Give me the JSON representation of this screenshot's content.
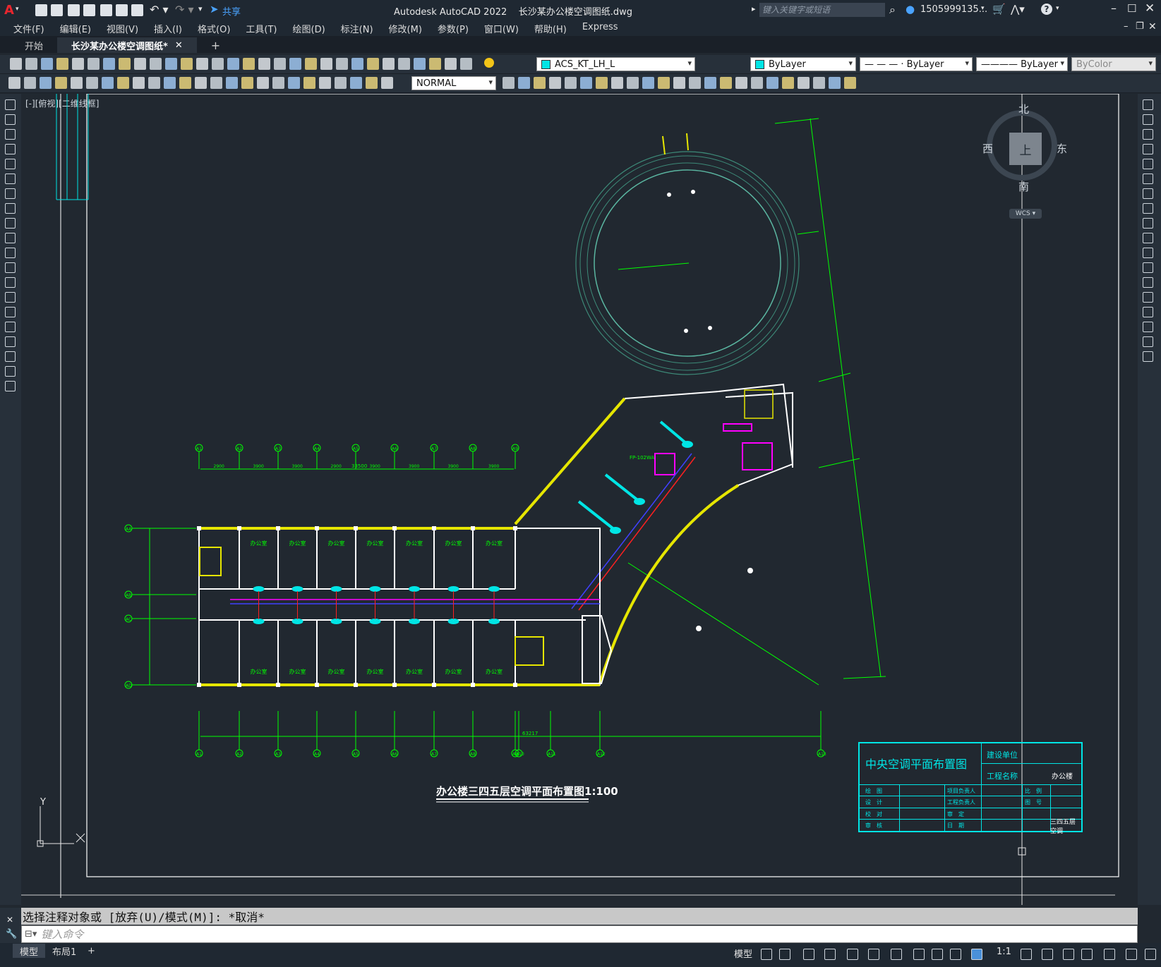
{
  "app": {
    "window_title": "Autodesk AutoCAD 2022    长沙某办公楼空调图纸.dwg",
    "share_label": "共享",
    "search_placeholder": "键入关键字或短语",
    "user_name": "1505999135..."
  },
  "menu": [
    "文件(F)",
    "编辑(E)",
    "视图(V)",
    "插入(I)",
    "格式(O)",
    "工具(T)",
    "绘图(D)",
    "标注(N)",
    "修改(M)",
    "参数(P)",
    "窗口(W)",
    "帮助(H)",
    "Express"
  ],
  "doc_tabs": [
    {
      "label": "开始",
      "active": false
    },
    {
      "label": "长沙某办公楼空调图纸*",
      "active": true
    }
  ],
  "properties": {
    "layer": "ACS_KT_LH_L",
    "color": "ByLayer",
    "linetype": "— — — · ByLayer",
    "lineweight": "———— ByLayer",
    "plotstyle": "ByColor",
    "dimstyle": "NORMAL",
    "layer_swatch": "#00e5e5",
    "color_swatch": "#00e5e5"
  },
  "viewport_label": "[-][俯视][二维线框]",
  "viewcube": {
    "north": "北",
    "south": "南",
    "east": "东",
    "west": "西",
    "face": "上",
    "wcs": "WCS"
  },
  "drawing": {
    "title": "办公楼三四五层空调平面布置图1:100",
    "title_block": {
      "name": "中央空调平面布置图",
      "fields": [
        "建设单位",
        "工程名称",
        "绘　图",
        "设　计",
        "校　对",
        "审　核",
        "项目负责人",
        "工程负责人",
        "审　定",
        "日　期",
        "比　例",
        "图　号"
      ],
      "project": "办公楼",
      "sheet": "三四五层空调"
    },
    "axis_labels": [
      "A1",
      "A2",
      "A3",
      "A4",
      "A5",
      "A6",
      "A7",
      "A8",
      "A9",
      "A10",
      "A11",
      "A12",
      "A13",
      "A14",
      "A15",
      "AA",
      "AB",
      "AC",
      "AD"
    ],
    "room_label": "办公室",
    "dim_top": [
      "2900",
      "3900",
      "3900",
      "2900",
      "3900",
      "3900",
      "3900",
      "3900"
    ],
    "dim_total_top": "33500",
    "dim_bottom_total": "63217",
    "fcu_label": "FP-102WA"
  },
  "ucs": {
    "y": "Y"
  },
  "command": {
    "history": "选择注释对象或 [放弃(U)/模式(M)]: *取消*",
    "placeholder": "键入命令"
  },
  "status": {
    "layout_tabs": [
      {
        "label": "模型",
        "active": true
      },
      {
        "label": "布局1",
        "active": false
      }
    ],
    "mode_label": "模型",
    "scale": "1:1"
  },
  "colors": {
    "line": "#00ff00",
    "wall": "#ffffff",
    "wall_yellow": "#e6e600",
    "cyan": "#00e5e5",
    "magenta": "#ff00ff",
    "bg": "#212830"
  }
}
